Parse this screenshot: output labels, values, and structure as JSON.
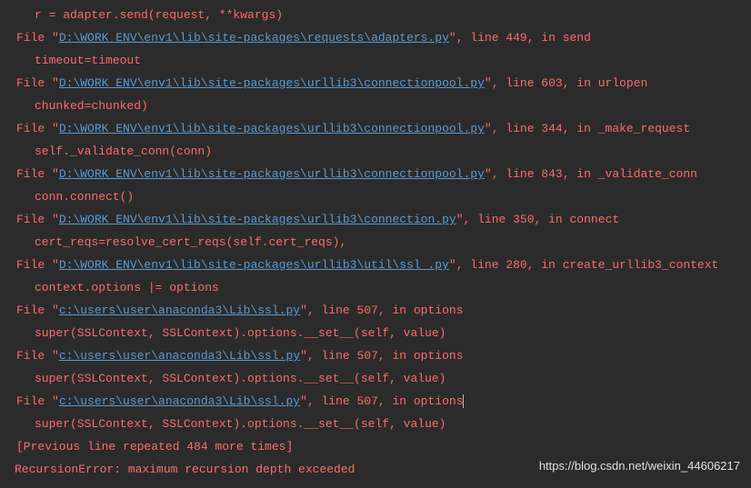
{
  "trace": [
    {
      "type": "code",
      "text": "r = adapter.send(request, **kwargs)"
    },
    {
      "type": "file",
      "prefix": "File \"",
      "path": "D:\\WORK ENV\\env1\\lib\\site-packages\\requests\\adapters.py",
      "suffix": "\", line 449, in send"
    },
    {
      "type": "code",
      "text": "timeout=timeout"
    },
    {
      "type": "file",
      "prefix": "File \"",
      "path": "D:\\WORK ENV\\env1\\lib\\site-packages\\urllib3\\connectionpool.py",
      "suffix": "\", line 603, in urlopen"
    },
    {
      "type": "code",
      "text": "chunked=chunked)"
    },
    {
      "type": "file",
      "prefix": "File \"",
      "path": "D:\\WORK ENV\\env1\\lib\\site-packages\\urllib3\\connectionpool.py",
      "suffix": "\", line 344, in _make_request"
    },
    {
      "type": "code",
      "text": "self._validate_conn(conn)"
    },
    {
      "type": "file",
      "prefix": "File \"",
      "path": "D:\\WORK ENV\\env1\\lib\\site-packages\\urllib3\\connectionpool.py",
      "suffix": "\", line 843, in _validate_conn"
    },
    {
      "type": "code",
      "text": "conn.connect()"
    },
    {
      "type": "file",
      "prefix": "File \"",
      "path": "D:\\WORK ENV\\env1\\lib\\site-packages\\urllib3\\connection.py",
      "suffix": "\", line 350, in connect"
    },
    {
      "type": "code",
      "text": "cert_reqs=resolve_cert_reqs(self.cert_reqs),"
    },
    {
      "type": "file",
      "prefix": "File \"",
      "path": "D:\\WORK ENV\\env1\\lib\\site-packages\\urllib3\\util\\ssl_.py",
      "suffix": "\", line 280, in create_urllib3_context"
    },
    {
      "type": "code",
      "text": "context.options |= options"
    },
    {
      "type": "file",
      "prefix": "File \"",
      "path": "c:\\users\\user\\anaconda3\\Lib\\ssl.py",
      "suffix": "\", line 507, in options"
    },
    {
      "type": "code",
      "text": "super(SSLContext, SSLContext).options.__set__(self, value)"
    },
    {
      "type": "file",
      "prefix": "File \"",
      "path": "c:\\users\\user\\anaconda3\\Lib\\ssl.py",
      "suffix": "\", line 507, in options"
    },
    {
      "type": "code",
      "text": "super(SSLContext, SSLContext).options.__set__(self, value)"
    },
    {
      "type": "file",
      "prefix": "File \"",
      "path": "c:\\users\\user\\anaconda3\\Lib\\ssl.py",
      "suffix": "\", line 507, in options",
      "cursor": true
    },
    {
      "type": "code",
      "text": "super(SSLContext, SSLContext).options.__set__(self, value)"
    },
    {
      "type": "plain",
      "text": "[Previous line repeated 484 more times]"
    }
  ],
  "error_line": "RecursionError: maximum recursion depth exceeded",
  "watermark": "https://blog.csdn.net/weixin_44606217"
}
